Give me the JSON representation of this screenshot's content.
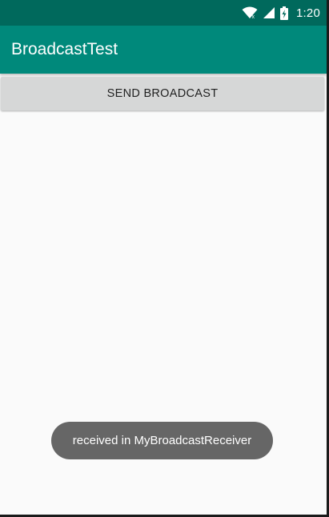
{
  "status_bar": {
    "time": "1:20",
    "icons": [
      "wifi-icon",
      "cell-signal-icon",
      "battery-charging-icon"
    ],
    "color": "#00695c"
  },
  "app_bar": {
    "title": "BroadcastTest",
    "color": "#00897b"
  },
  "main": {
    "send_button_label": "SEND BROADCAST"
  },
  "toast": {
    "message": "received in MyBroadcastReceiver"
  }
}
